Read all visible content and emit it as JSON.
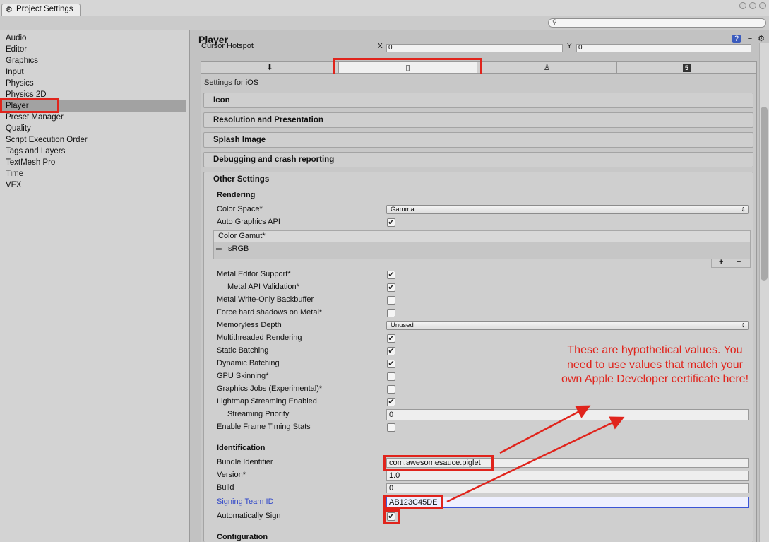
{
  "window": {
    "tab_title": "Project Settings"
  },
  "sidebar": {
    "items": [
      {
        "label": "Audio"
      },
      {
        "label": "Editor"
      },
      {
        "label": "Graphics"
      },
      {
        "label": "Input"
      },
      {
        "label": "Physics"
      },
      {
        "label": "Physics 2D"
      },
      {
        "label": "Player",
        "selected": true
      },
      {
        "label": "Preset Manager"
      },
      {
        "label": "Quality"
      },
      {
        "label": "Script Execution Order"
      },
      {
        "label": "Tags and Layers"
      },
      {
        "label": "TextMesh Pro"
      },
      {
        "label": "Time"
      },
      {
        "label": "VFX"
      }
    ]
  },
  "header": {
    "title": "Player",
    "clipped_row_label": "Cursor Hotspot",
    "x_label": "X",
    "x_value": "0",
    "y_label": "Y",
    "y_value": "0"
  },
  "platform_tabs": [
    {
      "icon": "download-icon",
      "active": false
    },
    {
      "icon": "mobile-phone-icon",
      "active": true
    },
    {
      "icon": "android-icon",
      "active": false
    },
    {
      "icon": "html5-icon",
      "active": false
    }
  ],
  "settings_for": "Settings for iOS",
  "sections": {
    "icon": "Icon",
    "resolution": "Resolution and Presentation",
    "splash": "Splash Image",
    "debugging": "Debugging and crash reporting",
    "other": "Other Settings"
  },
  "rendering": {
    "group": "Rendering",
    "color_space_label": "Color Space*",
    "color_space_value": "Gamma",
    "auto_graphics_label": "Auto Graphics API",
    "auto_graphics_checked": true,
    "color_gamut_label": "Color Gamut*",
    "color_gamut_item": "sRGB",
    "metal_editor_label": "Metal Editor Support*",
    "metal_editor_checked": true,
    "metal_api_label": "Metal API Validation*",
    "metal_api_checked": true,
    "metal_write_label": "Metal Write-Only Backbuffer",
    "metal_write_checked": false,
    "force_shadows_label": "Force hard shadows on Metal*",
    "force_shadows_checked": false,
    "memoryless_label": "Memoryless Depth",
    "memoryless_value": "Unused",
    "multithreaded_label": "Multithreaded Rendering",
    "multithreaded_checked": true,
    "static_batching_label": "Static Batching",
    "static_batching_checked": true,
    "dynamic_batching_label": "Dynamic Batching",
    "dynamic_batching_checked": true,
    "gpu_skinning_label": "GPU Skinning*",
    "gpu_skinning_checked": false,
    "graphics_jobs_label": "Graphics Jobs (Experimental)*",
    "graphics_jobs_checked": false,
    "lightmap_streaming_label": "Lightmap Streaming Enabled",
    "lightmap_streaming_checked": true,
    "streaming_priority_label": "Streaming Priority",
    "streaming_priority_value": "0",
    "frame_timing_label": "Enable Frame Timing Stats",
    "frame_timing_checked": false
  },
  "identification": {
    "group": "Identification",
    "bundle_label": "Bundle Identifier",
    "bundle_value": "com.awesomesauce.piglet",
    "version_label": "Version*",
    "version_value": "1.0",
    "build_label": "Build",
    "build_value": "0",
    "team_label": "Signing Team ID",
    "team_value": "AB123C45DE",
    "auto_sign_label": "Automatically Sign",
    "auto_sign_checked": true
  },
  "configuration": {
    "group": "Configuration"
  },
  "annotation": {
    "text": "These are hypothetical values. You need to use values that match your own Apple Developer certificate here!",
    "color": "#e0241c"
  },
  "colors": {
    "selected_row": "#a2a2a2",
    "link_label": "#3047c9",
    "annotation_red": "#e0241c"
  }
}
